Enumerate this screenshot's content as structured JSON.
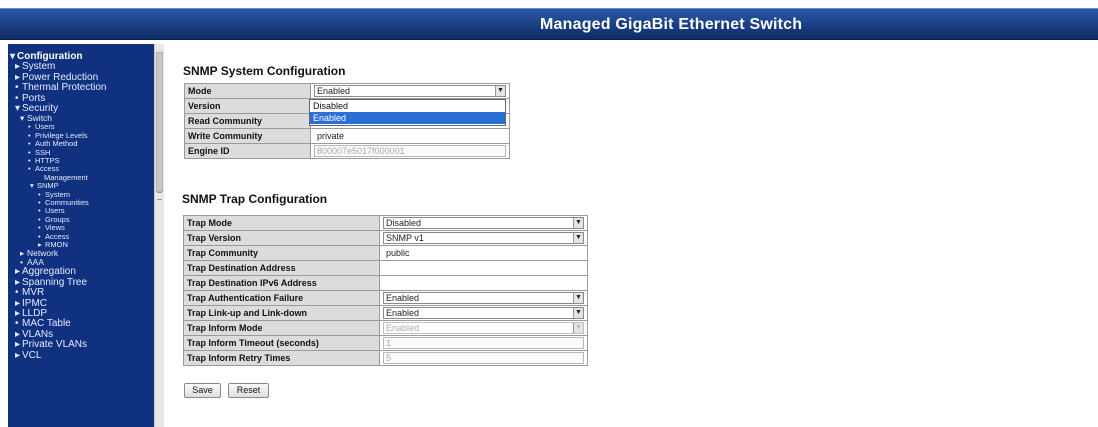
{
  "header": {
    "title": "Managed GigaBit Ethernet Switch"
  },
  "sidebar": {
    "items": [
      {
        "label": "Configuration",
        "marker": "▾",
        "level": "head"
      },
      {
        "label": "System",
        "marker": "▸",
        "level": "l0"
      },
      {
        "label": "Power Reduction",
        "marker": "▸",
        "level": "l0"
      },
      {
        "label": "Thermal Protection",
        "marker": "•",
        "level": "l0"
      },
      {
        "label": "Ports",
        "marker": "•",
        "level": "l0"
      },
      {
        "label": "Security",
        "marker": "▾",
        "level": "l0"
      },
      {
        "label": "Switch",
        "marker": "▾",
        "level": "l1"
      },
      {
        "label": "Users",
        "marker": "•",
        "level": "l2"
      },
      {
        "label": "Privilege Levels",
        "marker": "•",
        "level": "l2"
      },
      {
        "label": "Auth Method",
        "marker": "•",
        "level": "l2"
      },
      {
        "label": "SSH",
        "marker": "•",
        "level": "l2"
      },
      {
        "label": "HTTPS",
        "marker": "•",
        "level": "l2"
      },
      {
        "label": "Access",
        "marker": "•",
        "level": "l2"
      },
      {
        "label": "Management",
        "marker": "",
        "level": "l2"
      },
      {
        "label": "SNMP",
        "marker": "▾",
        "level": "l2"
      },
      {
        "label": "System",
        "marker": "•",
        "level": "l2"
      },
      {
        "label": "Communities",
        "marker": "•",
        "level": "l2"
      },
      {
        "label": "Users",
        "marker": "•",
        "level": "l2"
      },
      {
        "label": "Groups",
        "marker": "•",
        "level": "l2"
      },
      {
        "label": "Views",
        "marker": "•",
        "level": "l2"
      },
      {
        "label": "Access",
        "marker": "•",
        "level": "l2"
      },
      {
        "label": "RMON",
        "marker": "▸",
        "level": "l2"
      },
      {
        "label": "Network",
        "marker": "▸",
        "level": "l1"
      },
      {
        "label": "AAA",
        "marker": "•",
        "level": "l1"
      },
      {
        "label": "Aggregation",
        "marker": "▸",
        "level": "l0"
      },
      {
        "label": "Spanning Tree",
        "marker": "▸",
        "level": "l0"
      },
      {
        "label": "MVR",
        "marker": "•",
        "level": "l0"
      },
      {
        "label": "IPMC",
        "marker": "▸",
        "level": "l0"
      },
      {
        "label": "LLDP",
        "marker": "▸",
        "level": "l0"
      },
      {
        "label": "MAC Table",
        "marker": "•",
        "level": "l0"
      },
      {
        "label": "VLANs",
        "marker": "▸",
        "level": "l0"
      },
      {
        "label": "Private VLANs",
        "marker": "▸",
        "level": "l0"
      },
      {
        "label": "VCL",
        "marker": "▸",
        "level": "l0"
      }
    ]
  },
  "snmp_system": {
    "title": "SNMP System Configuration",
    "rows": [
      {
        "label": "Mode",
        "value": "Enabled"
      },
      {
        "label": "Version",
        "value": ""
      },
      {
        "label": "Read Community",
        "value": ""
      },
      {
        "label": "Write Community",
        "value": "private"
      },
      {
        "label": "Engine ID",
        "value": "800007e5017f000001"
      }
    ],
    "mode_dropdown": {
      "options": [
        "Disabled",
        "Enabled"
      ],
      "highlighted": "Enabled"
    }
  },
  "snmp_trap": {
    "title": "SNMP Trap Configuration",
    "rows": [
      {
        "label": "Trap Mode",
        "value": "Disabled"
      },
      {
        "label": "Trap Version",
        "value": "SNMP v1"
      },
      {
        "label": "Trap Community",
        "value": "public"
      },
      {
        "label": "Trap Destination Address",
        "value": ""
      },
      {
        "label": "Trap Destination IPv6 Address",
        "value": ""
      },
      {
        "label": "Trap Authentication Failure",
        "value": "Enabled"
      },
      {
        "label": "Trap Link-up and Link-down",
        "value": "Enabled"
      },
      {
        "label": "Trap Inform Mode",
        "value": "Enabled"
      },
      {
        "label": "Trap Inform Timeout (seconds)",
        "value": "1"
      },
      {
        "label": "Trap Inform Retry Times",
        "value": "5"
      }
    ]
  },
  "buttons": {
    "save": "Save",
    "reset": "Reset"
  }
}
